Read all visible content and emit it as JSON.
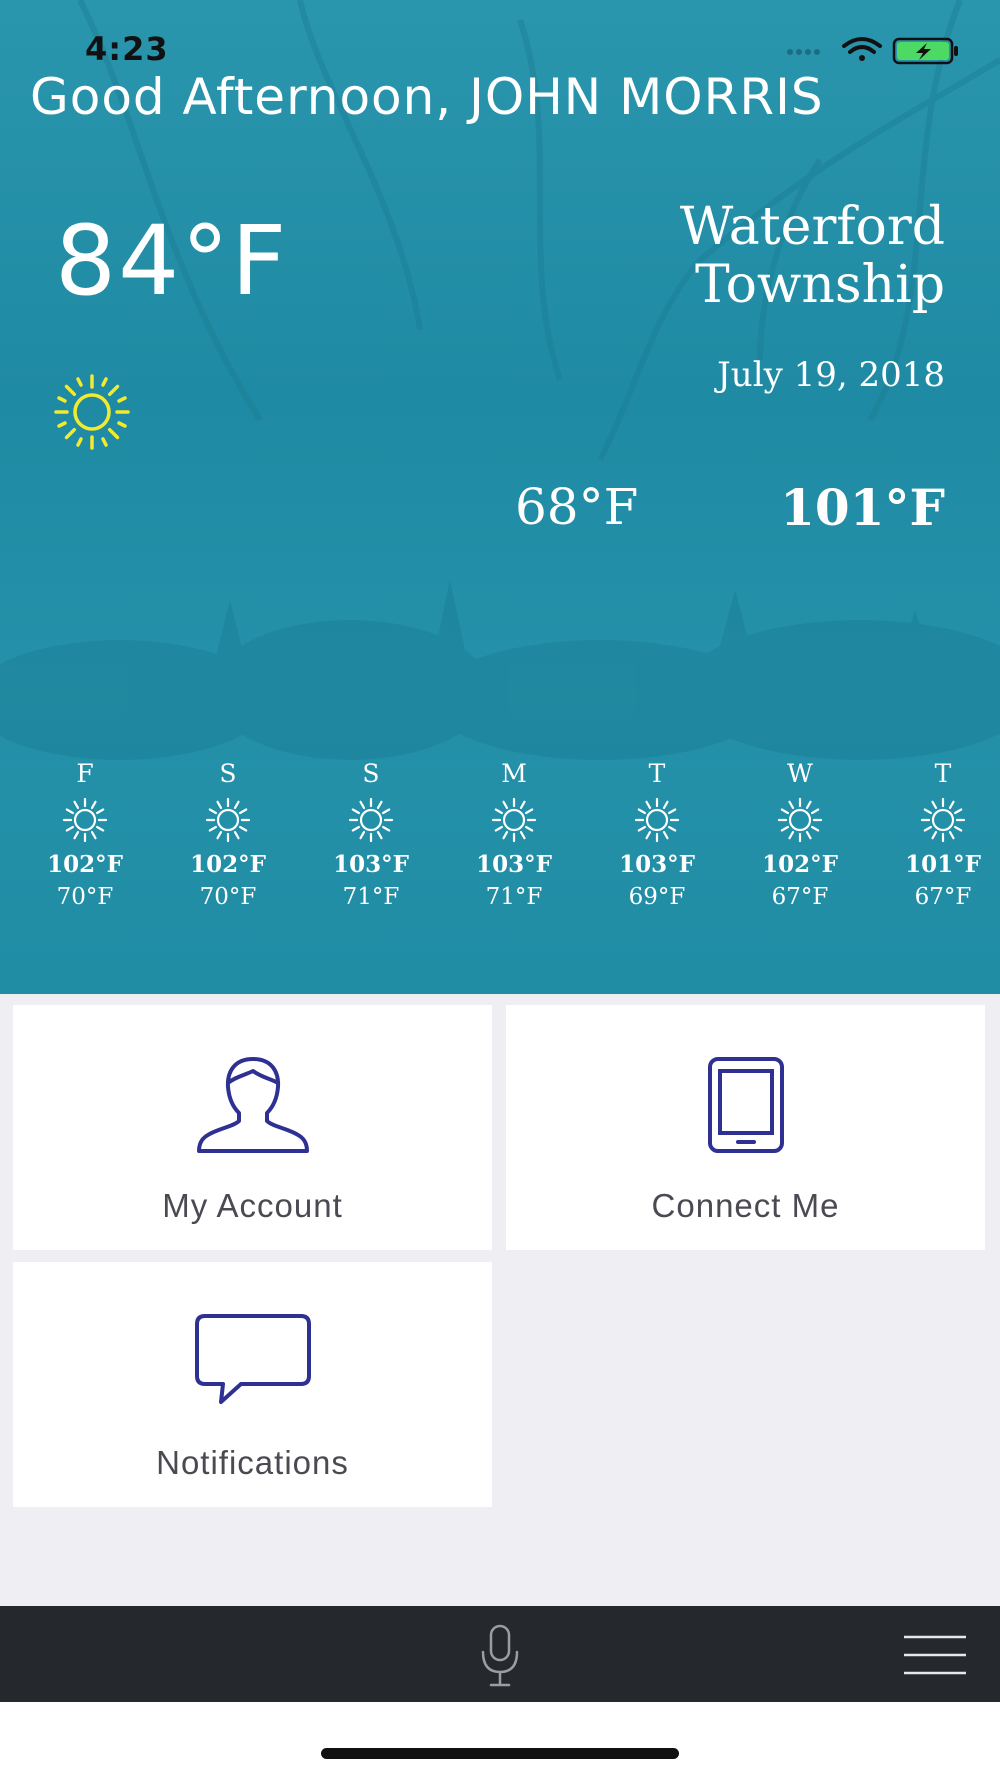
{
  "status_bar": {
    "time": "4:23",
    "icons": [
      "signal-dots-icon",
      "wifi-icon",
      "battery-charging-icon"
    ],
    "battery_color": "#4cd964"
  },
  "weather": {
    "greeting": "Good Afternoon, JOHN MORRIS",
    "current_temp": "84°F",
    "current_icon": "sun-icon",
    "sun_color": "#f2ea2e",
    "location_line1": "Waterford",
    "location_line2": "Township",
    "date": "July 19, 2018",
    "low": "68°F",
    "high": "101°F",
    "background_color": "#2392aa",
    "forecast": [
      {
        "day": "F",
        "high": "102°F",
        "low": "70°F",
        "icon": "sun-icon"
      },
      {
        "day": "S",
        "high": "102°F",
        "low": "70°F",
        "icon": "sun-icon"
      },
      {
        "day": "S",
        "high": "103°F",
        "low": "71°F",
        "icon": "sun-icon"
      },
      {
        "day": "M",
        "high": "103°F",
        "low": "71°F",
        "icon": "sun-icon"
      },
      {
        "day": "T",
        "high": "103°F",
        "low": "69°F",
        "icon": "sun-icon"
      },
      {
        "day": "W",
        "high": "102°F",
        "low": "67°F",
        "icon": "sun-icon"
      },
      {
        "day": "T",
        "high": "101°F",
        "low": "67°F",
        "icon": "sun-icon"
      }
    ]
  },
  "tiles": {
    "my_account": {
      "label": "My Account",
      "icon": "user-icon"
    },
    "connect_me": {
      "label": "Connect Me",
      "icon": "tablet-icon"
    },
    "notifications": {
      "label": "Notifications",
      "icon": "chat-bubble-icon"
    },
    "icon_color": "#2e3192"
  },
  "bottom_bar": {
    "mic_icon": "microphone-icon",
    "menu_icon": "hamburger-menu-icon",
    "background_color": "#25282c"
  }
}
